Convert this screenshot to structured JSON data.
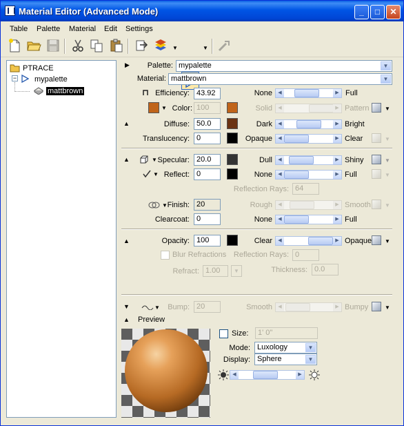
{
  "window": {
    "title": "Material Editor (Advanced Mode)",
    "min": "_",
    "max": "□",
    "close": "✕"
  },
  "menubar": [
    "Table",
    "Palette",
    "Material",
    "Edit",
    "Settings"
  ],
  "tree": {
    "root": "PTRACE",
    "palette": "mypalette",
    "material": "mattbrown"
  },
  "header": {
    "palette_label": "Palette:",
    "palette_value": "mypalette",
    "material_label": "Material:",
    "material_value": "mattbrown"
  },
  "efficiency": {
    "label": "Efficiency:",
    "value": "43.92",
    "min": "None",
    "max": "Full",
    "level": 0.44
  },
  "color": {
    "label": "Color:",
    "value": "100",
    "min": "Solid",
    "max": "Pattern",
    "swatch": "#c0641a"
  },
  "diffuse": {
    "label": "Diffuse:",
    "value": "50.0",
    "min": "Dark",
    "max": "Bright",
    "swatch": "#6b3312",
    "level": 0.5
  },
  "translucency": {
    "label": "Translucency:",
    "value": "0",
    "min": "Opaque",
    "max": "Clear",
    "swatch": "#000000",
    "level": 0.0
  },
  "specular": {
    "label": "Specular:",
    "value": "20.0",
    "min": "Dull",
    "max": "Shiny",
    "swatch": "#333333",
    "level": 0.2
  },
  "reflect": {
    "label": "Reflect:",
    "value": "0",
    "min": "None",
    "max": "Full",
    "swatch": "#000000",
    "level": 0.0
  },
  "reflection_rays": {
    "label": "Reflection Rays:",
    "value": "64"
  },
  "finish": {
    "label": "Finish:",
    "value": "20",
    "min": "Rough",
    "max": "Smooth"
  },
  "clearcoat": {
    "label": "Clearcoat:",
    "value": "0",
    "min": "None",
    "max": "Full",
    "level": 0.0
  },
  "opacity": {
    "label": "Opacity:",
    "value": "100",
    "min": "Clear",
    "max": "Opaque",
    "swatch": "#000000",
    "level": 1.0
  },
  "refractions": {
    "blur_label": "Blur Refractions",
    "rays_label": "Reflection Rays:",
    "rays_value": "0",
    "refract_label": "Refract:",
    "refract_value": "1.00",
    "thickness_label": "Thickness:",
    "thickness_value": "0.0"
  },
  "bump": {
    "label": "Bump:",
    "value": "20",
    "min": "Smooth",
    "max": "Bumpy"
  },
  "preview": {
    "label": "Preview",
    "size_label": "Size:",
    "size_value": "1' 0\"",
    "mode_label": "Mode:",
    "mode_value": "Luxology",
    "display_label": "Display:",
    "display_value": "Sphere"
  },
  "colors": {
    "title_bar": "#0055e5",
    "panel": "#ece9d8",
    "material": "#c0641a"
  }
}
